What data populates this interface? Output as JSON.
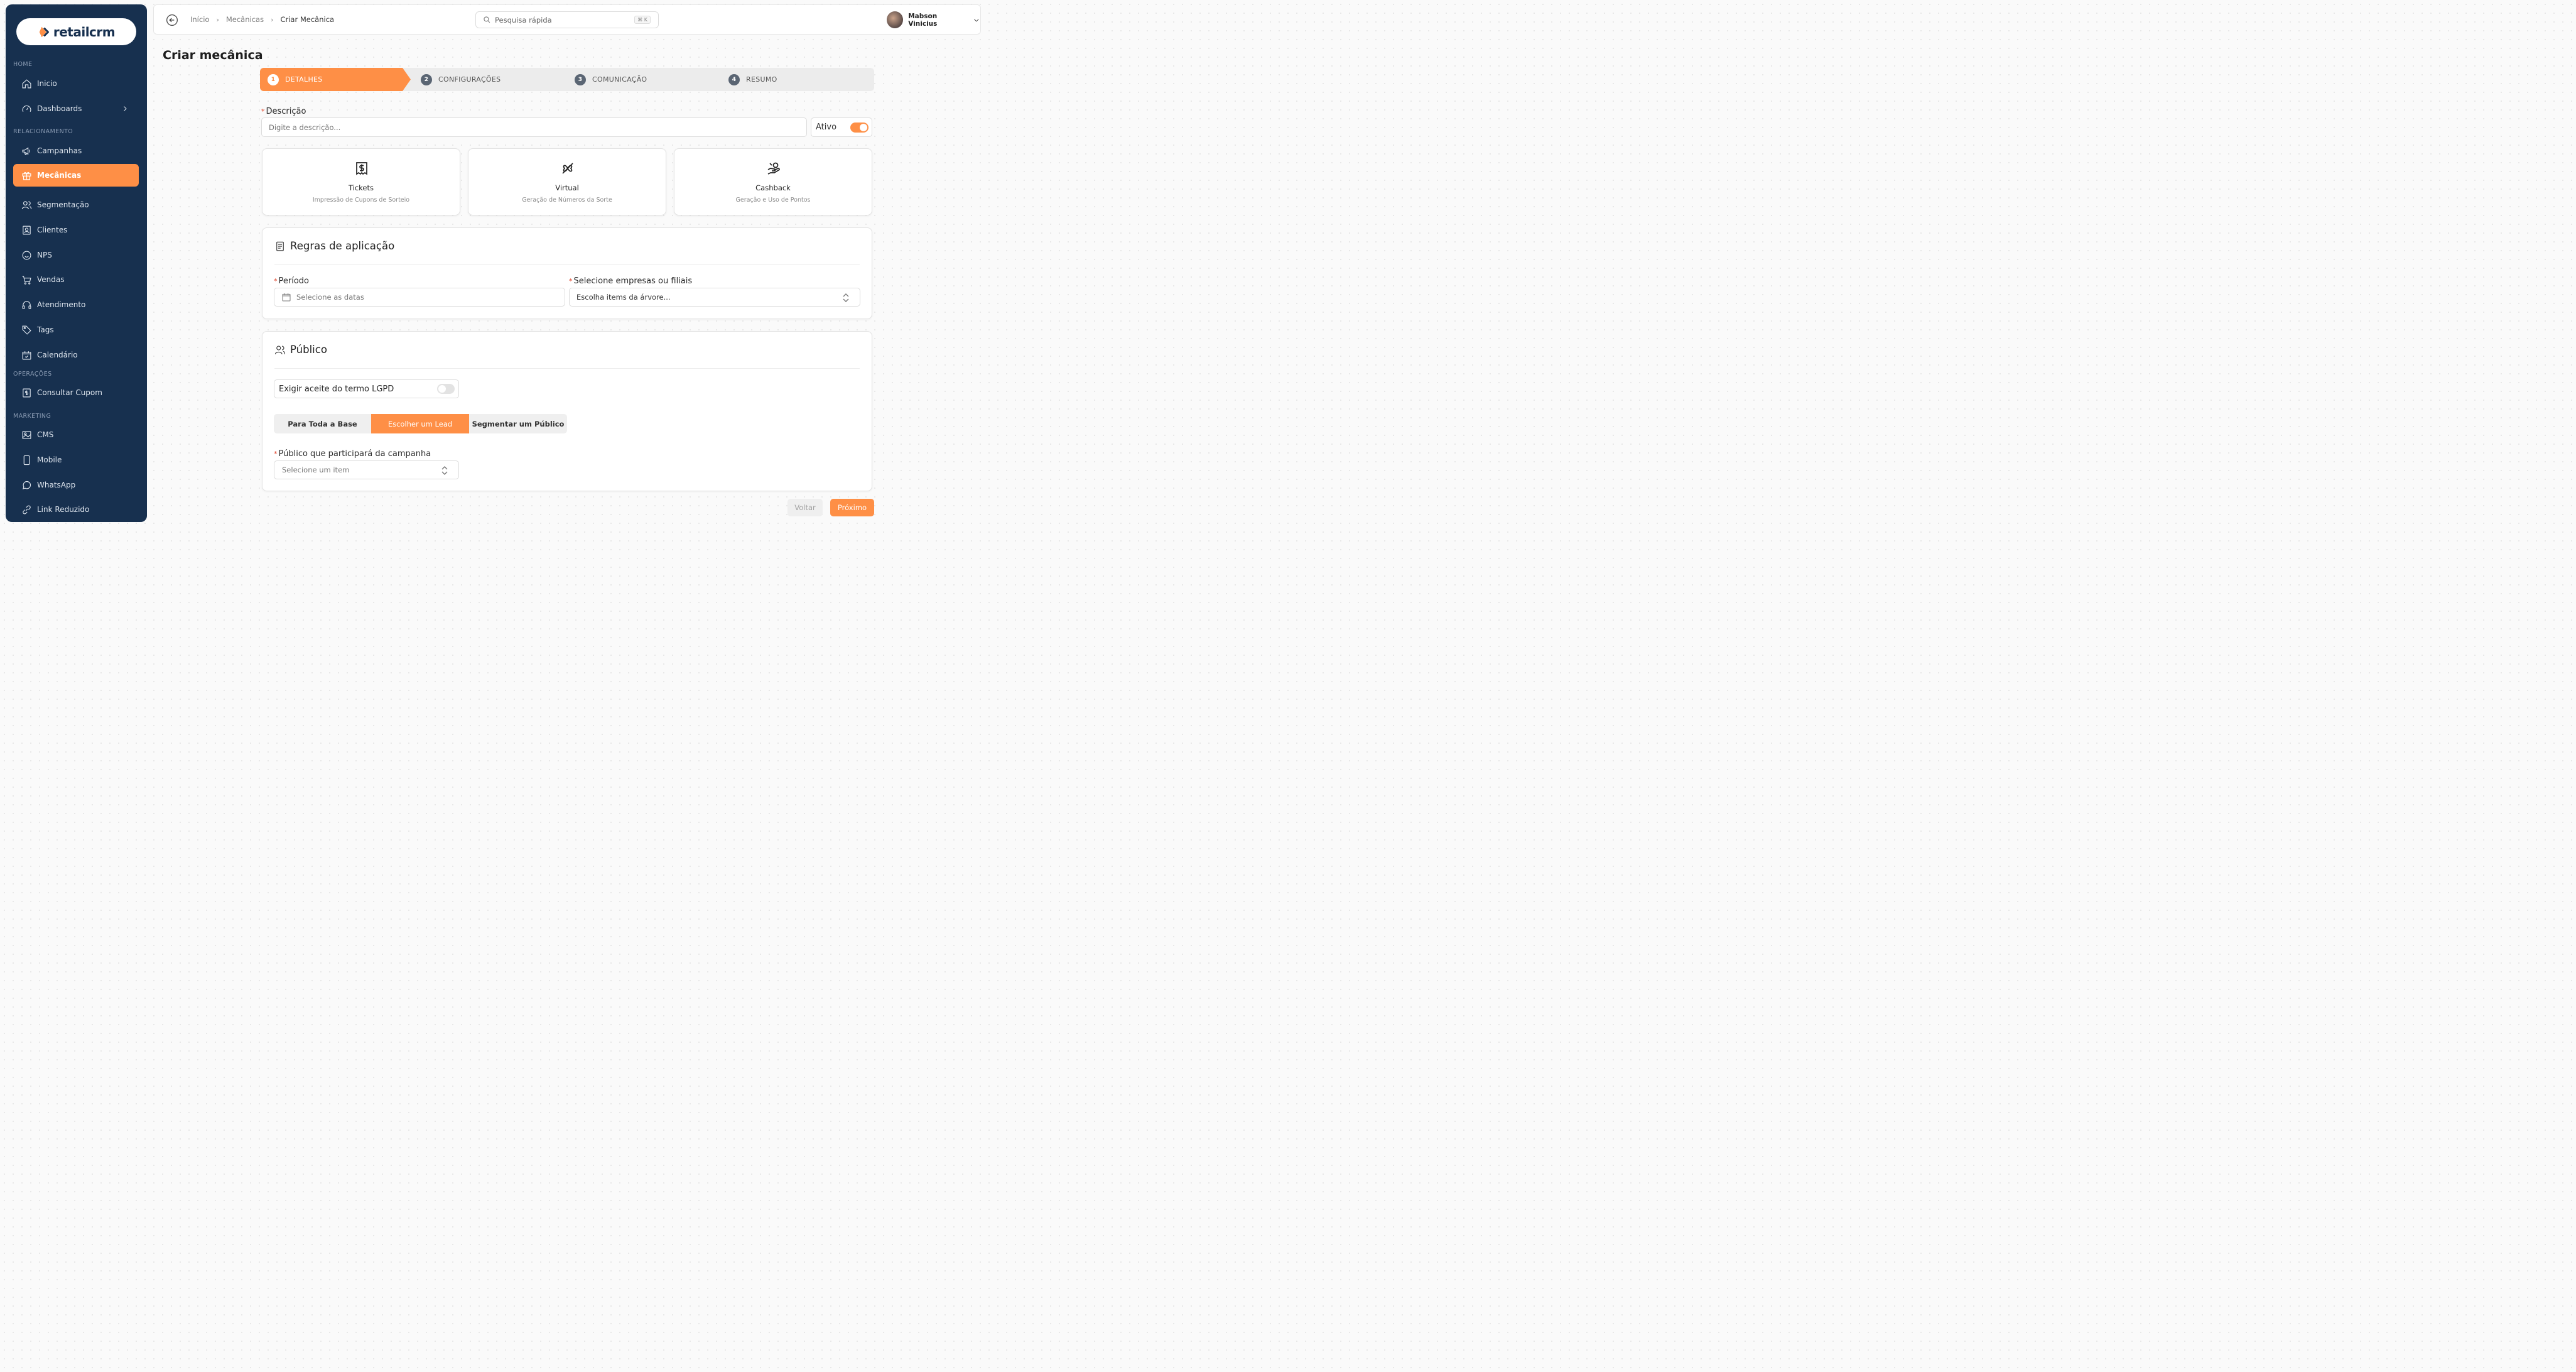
{
  "brand": {
    "name": "retailcrm",
    "accent": "#fe8f46",
    "sidebar_bg": "#17304f"
  },
  "sidebar": {
    "sections": {
      "home": "HOME",
      "relacionamento": "RELACIONAMENTO",
      "operacoes": "OPERAÇÕES",
      "marketing": "MARKETING"
    },
    "items": [
      {
        "label": "Inicio",
        "icon": "home-icon"
      },
      {
        "label": "Dashboards",
        "icon": "gauge-icon"
      },
      {
        "label": "Campanhas",
        "icon": "megaphone-icon"
      },
      {
        "label": "Mecânicas",
        "icon": "gift-icon",
        "active": true
      },
      {
        "label": "Segmentação",
        "icon": "users-icon"
      },
      {
        "label": "Clientes",
        "icon": "contact-icon"
      },
      {
        "label": "NPS",
        "icon": "smile-icon"
      },
      {
        "label": "Vendas",
        "icon": "cart-icon"
      },
      {
        "label": "Atendimento",
        "icon": "headset-icon"
      },
      {
        "label": "Tags",
        "icon": "tag-icon"
      },
      {
        "label": "Calendário",
        "icon": "calendar-icon"
      },
      {
        "label": "Consultar Cupom",
        "icon": "coupon-icon"
      },
      {
        "label": "CMS",
        "icon": "image-icon"
      },
      {
        "label": "Mobile",
        "icon": "mobile-icon"
      },
      {
        "label": "WhatsApp",
        "icon": "chat-icon"
      },
      {
        "label": "Link Reduzido",
        "icon": "link-icon"
      }
    ]
  },
  "header": {
    "breadcrumb": [
      "Início",
      "Mecânicas",
      "Criar Mecânica"
    ],
    "search_placeholder": "Pesquisa rápida",
    "search_shortcut": "⌘ K",
    "user_name": "Mabson Vinicius"
  },
  "page_title": "Criar mecânica",
  "stepper": {
    "steps": [
      {
        "num": "1",
        "label": "DETALHES",
        "active": true
      },
      {
        "num": "2",
        "label": "CONFIGURAÇÕES"
      },
      {
        "num": "3",
        "label": "COMUNICAÇÃO"
      },
      {
        "num": "4",
        "label": "RESUMO"
      }
    ]
  },
  "descricao": {
    "label": "Descrição",
    "placeholder": "Digite a descrição...",
    "ativo_label": "Ativo",
    "ativo_on": true
  },
  "mechanics": [
    {
      "title": "Tickets",
      "subtitle": "Impressão de Cupons de Sorteio",
      "icon": "ticket-dollar-icon"
    },
    {
      "title": "Virtual",
      "subtitle": "Geração de Números da Sorte",
      "icon": "clover-icon"
    },
    {
      "title": "Cashback",
      "subtitle": "Geração e Uso de Pontos",
      "icon": "cashback-hand-icon"
    }
  ],
  "regras": {
    "title": "Regras de aplicação",
    "periodo_label": "Período",
    "periodo_placeholder": "Selecione as datas",
    "empresas_label": "Selecione empresas ou filiais",
    "empresas_placeholder": "Escolha items da árvore..."
  },
  "publico": {
    "title": "Público",
    "lgpd_label": "Exigir aceite do termo LGPD",
    "lgpd_on": false,
    "segments": [
      "Para Toda a Base",
      "Escolher um Lead",
      "Segmentar um Público"
    ],
    "selected_segment": "Escolher um Lead",
    "participa_label": "Público que participará da campanha",
    "participa_placeholder": "Selecione um item"
  },
  "footer": {
    "back_label": "Voltar",
    "next_label": "Próximo"
  }
}
